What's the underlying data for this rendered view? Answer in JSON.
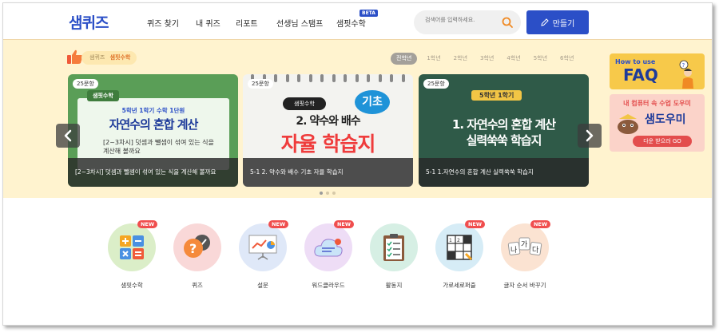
{
  "header": {
    "logo": "샘퀴즈",
    "nav": [
      "퀴즈 찾기",
      "내 퀴즈",
      "리포트",
      "선생님 스탬프",
      "샘핏수학"
    ],
    "beta_badge": "BETA",
    "search_placeholder": "검색어를 입력하세요.",
    "make_button": "만들기"
  },
  "banner": {
    "breadcrumb": [
      "샘퀴즈",
      "샘핏수학"
    ],
    "grades": [
      "전학년",
      "1학년",
      "2학년",
      "3학년",
      "4학년",
      "5학년",
      "6학년"
    ],
    "active_grade": "전학년",
    "cards": [
      {
        "badge": "25문항",
        "tag": "샘핏수학",
        "line1": "5학년 1학기 수학 1단원",
        "line2": "자연수의 혼합 계산",
        "line3": "[2~3차시] 덧셈과 뺄셈이 섞여 있는 식을",
        "line4": "계산해 볼까요",
        "caption": "[2~3차시] 덧셈과 뺄셈이 섞여 있는 식을 계산해 볼까요"
      },
      {
        "badge": "25문항",
        "tag": "샘핏수학",
        "circle": "기초",
        "line1": "2. 약수와 배수",
        "line2": "자율 학습지",
        "caption": "5-1 2. 약수와 배수 기초 자율 학습지"
      },
      {
        "badge": "25문항",
        "tag": "5학년 1학기",
        "line1": "1. 자연수의 혼합 계산",
        "line2": "실력쑥쑥 학습지",
        "caption": "5-1 1.자연수의 혼합 계산 실력쑥쑥 학습지"
      }
    ],
    "faq": {
      "how": "How to use",
      "title": "FAQ"
    },
    "dowoomi": {
      "line1": "내 컴퓨터 속 수업 도우미",
      "title": "샘도우미",
      "button": "다운 받으러 GO"
    }
  },
  "tools": [
    {
      "label": "샘핏수학",
      "new": "NEW",
      "bg": "#dbeec8"
    },
    {
      "label": "퀴즈",
      "new": "",
      "bg": "#f9d8d8"
    },
    {
      "label": "설문",
      "new": "NEW",
      "bg": "#dfe8f8"
    },
    {
      "label": "워드클라우드",
      "new": "NEW",
      "bg": "#eeddf6"
    },
    {
      "label": "활동지",
      "new": "",
      "bg": "#d6efe4"
    },
    {
      "label": "가로세로퍼즐",
      "new": "NEW",
      "bg": "#d6ecf6"
    },
    {
      "label": "글자 순서 바꾸기",
      "new": "NEW",
      "bg": "#fbe3d2"
    }
  ],
  "colors": {
    "brand": "#2b4fc7",
    "banner_bg": "#fff3cf",
    "new_badge": "#f04e4e"
  }
}
